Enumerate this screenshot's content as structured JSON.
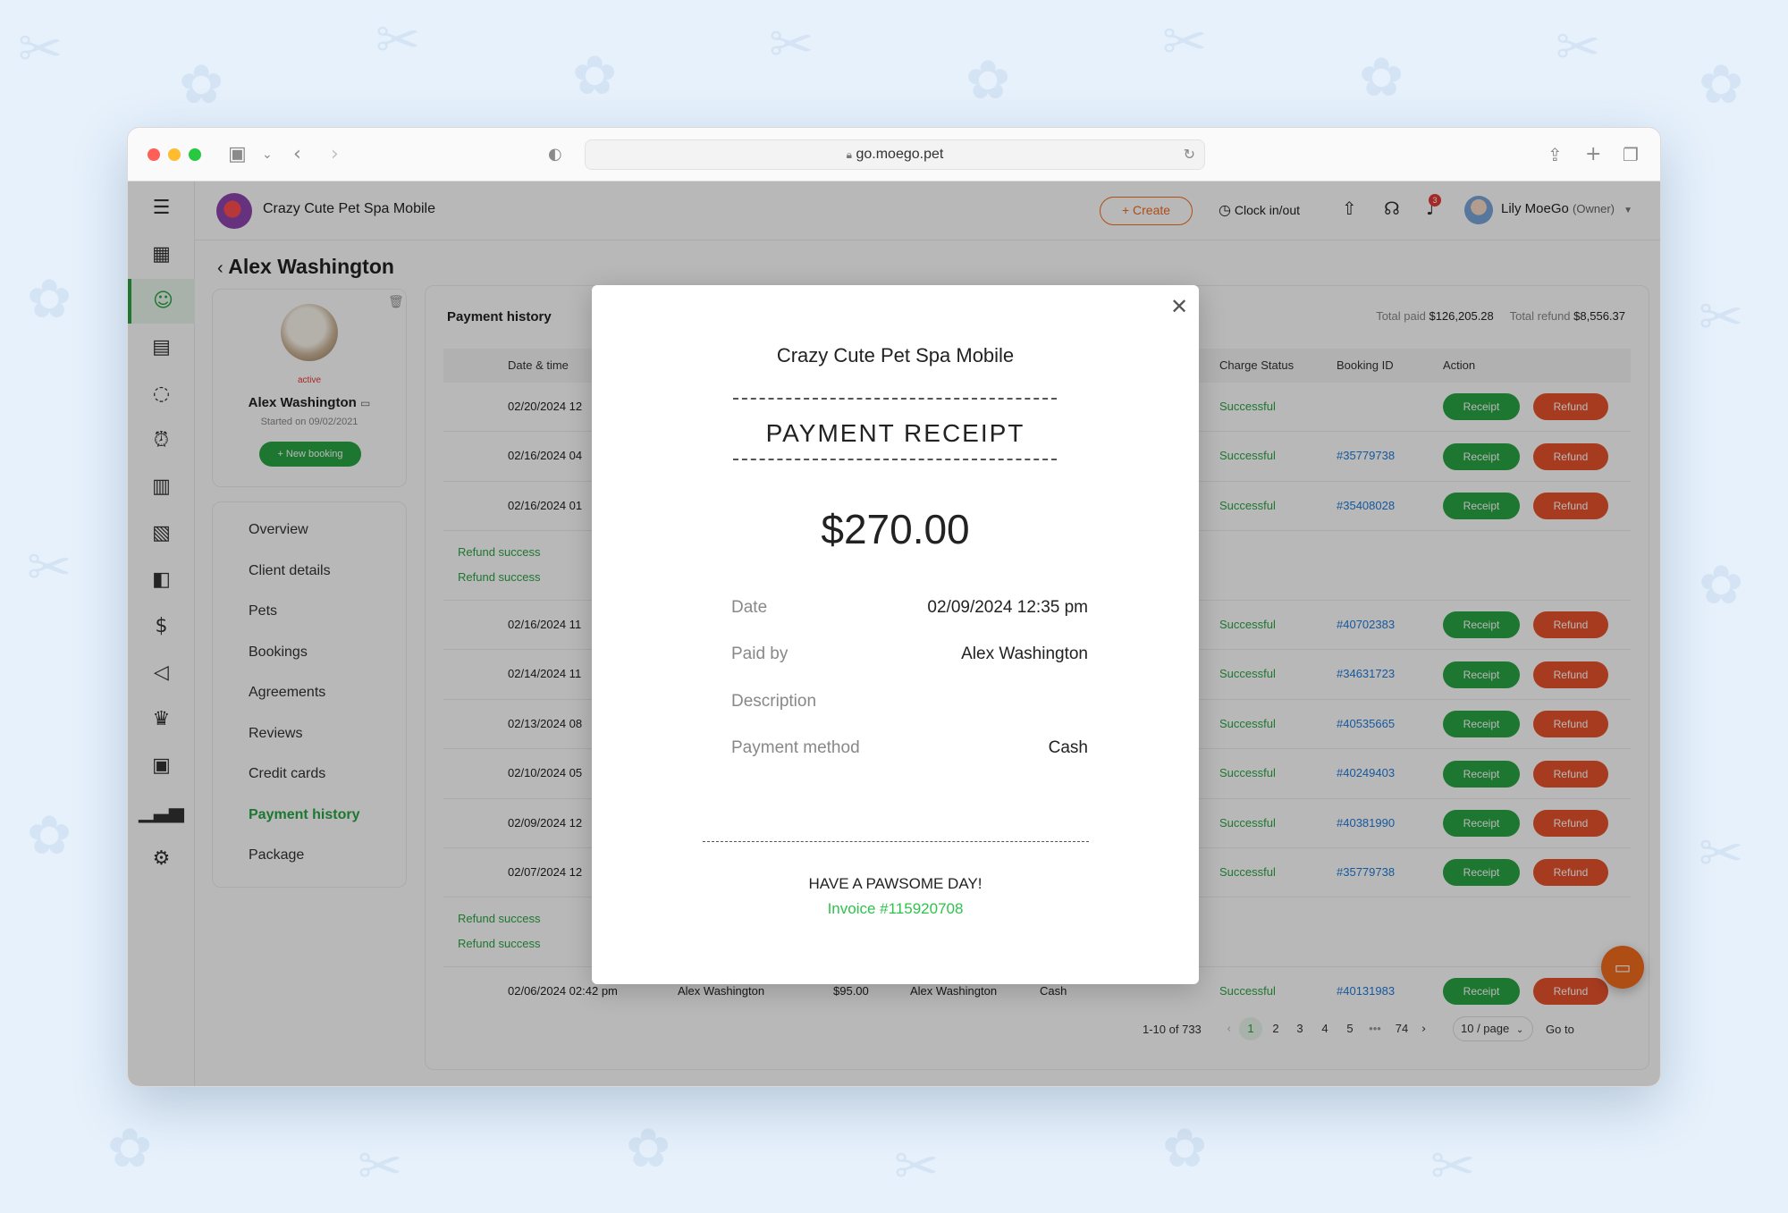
{
  "browser": {
    "url": "go.moego.pet"
  },
  "topbar": {
    "business_name": "Crazy Cute Pet Spa Mobile",
    "create_label": "+ Create",
    "clock_label": "Clock in/out",
    "notification_count": "3",
    "user_name": "Lily MoeGo",
    "user_role": "(Owner)"
  },
  "page": {
    "title": "Alex Washington"
  },
  "profile": {
    "status": "active",
    "name": "Alex Washington",
    "started": "Started on 09/02/2021",
    "new_booking": "+ New booking"
  },
  "menu": [
    "Overview",
    "Client details",
    "Pets",
    "Bookings",
    "Agreements",
    "Reviews",
    "Credit cards",
    "Payment history",
    "Package"
  ],
  "history": {
    "title": "Payment history",
    "total_paid_label": "Total paid",
    "total_paid": "$126,205.28",
    "total_refund_label": "Total refund",
    "total_refund": "$8,556.37",
    "columns": {
      "date": "Date & time",
      "charge_status": "Charge Status",
      "booking_id": "Booking ID",
      "action": "Action"
    },
    "receipt_label": "Receipt",
    "refund_label": "Refund",
    "refund_success": "Refund success",
    "rows": [
      {
        "date": "02/20/2024 12",
        "status": "Successful",
        "booking": ""
      },
      {
        "date": "02/16/2024 04",
        "status": "Successful",
        "booking": "#35779738"
      },
      {
        "date": "02/16/2024 01",
        "status": "Successful",
        "booking": "#35408028"
      },
      {
        "date": "02/16/2024 11",
        "status": "Successful",
        "booking": "#40702383"
      },
      {
        "date": "02/14/2024 11",
        "status": "Successful",
        "booking": "#34631723"
      },
      {
        "date": "02/13/2024 08",
        "status": "Successful",
        "booking": "#40535665"
      },
      {
        "date": "02/10/2024 05",
        "status": "Successful",
        "booking": "#40249403"
      },
      {
        "date": "02/09/2024 12",
        "status": "Successful",
        "booking": "#40381990"
      },
      {
        "date": "02/07/2024 12",
        "status": "Successful",
        "booking": "#35779738"
      }
    ],
    "last_row": {
      "date": "02/06/2024 02:42 pm",
      "client": "Alex Washington",
      "amount": "$95.00",
      "paid_by": "Alex Washington",
      "method": "Cash",
      "status": "Successful",
      "booking": "#40131983"
    },
    "pagination": {
      "range": "1-10 of 733",
      "pages": [
        "1",
        "2",
        "3",
        "4",
        "5",
        "•••",
        "74"
      ],
      "page_size": "10 / page",
      "goto": "Go to"
    }
  },
  "receipt": {
    "business": "Crazy Cute Pet Spa Mobile",
    "title": "PAYMENT RECEIPT",
    "amount": "$270.00",
    "date_label": "Date",
    "date_value": "02/09/2024 12:35 pm",
    "paid_by_label": "Paid by",
    "paid_by_value": "Alex Washington",
    "description_label": "Description",
    "description_value": "",
    "method_label": "Payment method",
    "method_value": "Cash",
    "footer": "HAVE A PAWSOME DAY!",
    "invoice": "Invoice #115920708"
  },
  "colors": {
    "brand_green": "#2aa544",
    "refund_orange": "#e8522c",
    "accent_orange": "#f26b1d",
    "link_blue": "#1f7ad9"
  }
}
